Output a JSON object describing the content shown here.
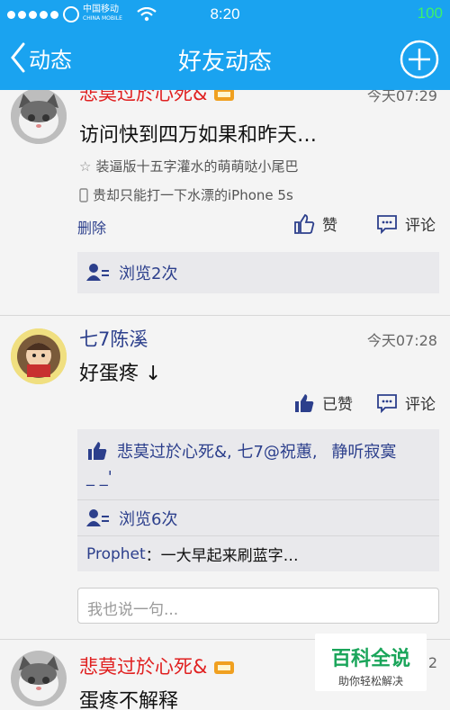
{
  "status": {
    "carrier_cn": "中国移动",
    "carrier_en": "CHINA MOBILE",
    "time": "8:20",
    "battery": "100"
  },
  "nav": {
    "back_label": "动态",
    "title": "好友动态"
  },
  "posts": [
    {
      "name": "悲莫过於心死&",
      "time": "今天07:29",
      "content": "访问快到四万如果和昨天…",
      "tagline": "装逼版十五字灌水的萌萌哒小尾巴",
      "device": "贵却只能打一下水漂的iPhone 5s",
      "delete_label": "删除",
      "like_label": "赞",
      "comment_label": "评论",
      "views": "浏览2次"
    },
    {
      "name": "七7陈溪",
      "time": "今天07:28",
      "content": "好蛋疼",
      "liked_label": "已赞",
      "comment_label": "评论",
      "likers": "悲莫过於心死&, 七7@祝蕙,",
      "likers_more": "静听寂寞",
      "likers_line2": "_ _'",
      "views": "浏览6次",
      "comment_author": "Prophet",
      "comment_text": "：一大早起来刷蓝字…",
      "input_placeholder": "我也说一句..."
    },
    {
      "name": "悲莫过於心死&",
      "time_partial": "2",
      "content": "蛋疼不解释"
    }
  ],
  "watermark": {
    "main": "百科全说",
    "sub": "助你轻松解决"
  },
  "icons": {
    "back": "chevron-left-icon",
    "add": "plus-circle-icon",
    "like": "thumbs-up-icon",
    "comment": "comment-bubble-icon",
    "views": "users-icon",
    "star": "star-icon",
    "phone": "phone-icon",
    "vip": "vip-badge-icon"
  },
  "colors": {
    "nav": "#1aa3f0",
    "name_red": "#e02020",
    "name_blue": "#2c3f8c"
  }
}
